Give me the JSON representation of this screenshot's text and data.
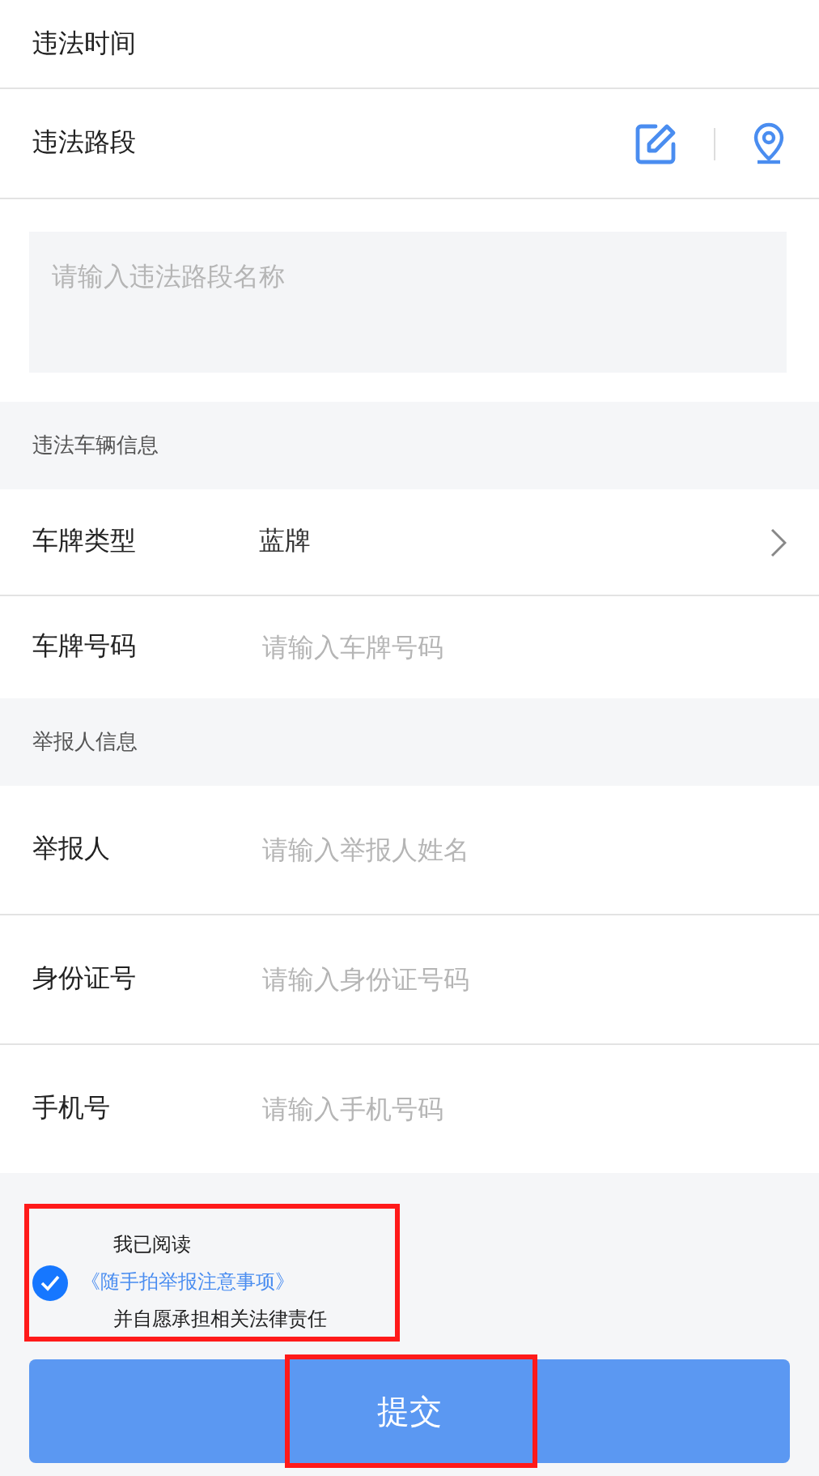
{
  "violation": {
    "rows": [
      {
        "kind": "plain",
        "label": "违法时间"
      },
      {
        "kind": "location",
        "label": "违法路段"
      }
    ],
    "road_field": {
      "placeholder": "请输入违法路段名称"
    }
  },
  "sections": [
    {
      "title": "违法车辆信息",
      "rows": [
        {
          "kind": "select",
          "label": "车牌类型",
          "value": "蓝牌"
        },
        {
          "kind": "input",
          "label": "车牌号码",
          "placeholder": "请输入车牌号码"
        }
      ]
    },
    {
      "title": "举报人信息",
      "rows": [
        {
          "kind": "input",
          "label": "举报人",
          "placeholder": "请输入举报人姓名"
        },
        {
          "kind": "input",
          "label": "身份证号",
          "placeholder": "请输入身份证号码"
        },
        {
          "kind": "input",
          "label": "手机号",
          "placeholder": "请输入手机号码"
        }
      ]
    }
  ],
  "agreement": {
    "checked": true,
    "annotated": true,
    "before": "我已阅读",
    "link": "《随手拍举报注意事项》",
    "after": "并自愿承担相关法律责任"
  },
  "submit": {
    "label": "提交",
    "annotated": true
  }
}
